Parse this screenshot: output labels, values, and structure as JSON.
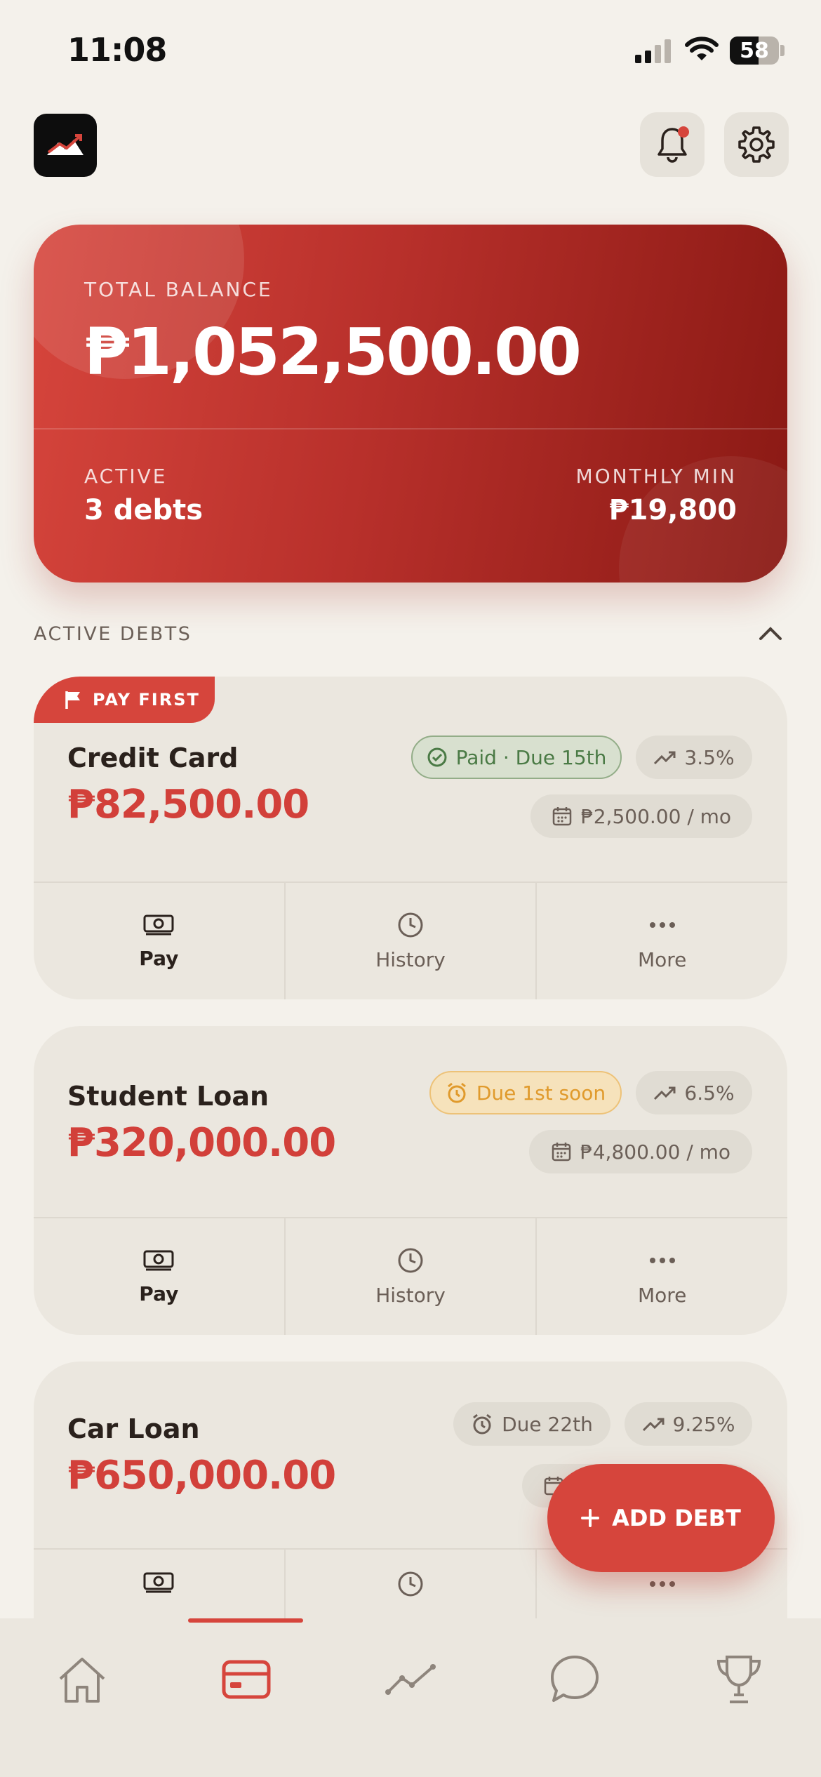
{
  "status_bar": {
    "time": "11:08",
    "battery": "58"
  },
  "balance": {
    "label": "TOTAL BALANCE",
    "amount": "₱1,052,500.00",
    "active_label": "ACTIVE",
    "active_value": "3 debts",
    "monthly_label": "MONTHLY MIN",
    "monthly_value": "₱19,800"
  },
  "section": {
    "title": "ACTIVE DEBTS"
  },
  "debts": [
    {
      "badge": "PAY FIRST",
      "name": "Credit Card",
      "amount": "₱82,500.00",
      "status": "Paid · Due 15th",
      "rate": "3.5%",
      "monthly": "₱2,500.00 / mo",
      "actions": [
        "Pay",
        "History",
        "More"
      ]
    },
    {
      "name": "Student Loan",
      "amount": "₱320,000.00",
      "status": "Due 1st soon",
      "rate": "6.5%",
      "monthly": "₱4,800.00 / mo",
      "actions": [
        "Pay",
        "History",
        "More"
      ]
    },
    {
      "name": "Car Loan",
      "amount": "₱650,000.00",
      "status": "Due 22th",
      "rate": "9.25%"
    }
  ],
  "fab": {
    "label": "ADD DEBT"
  },
  "colors": {
    "accent": "#d6453c",
    "background": "#f4f1eb",
    "card": "#ebe7df"
  }
}
